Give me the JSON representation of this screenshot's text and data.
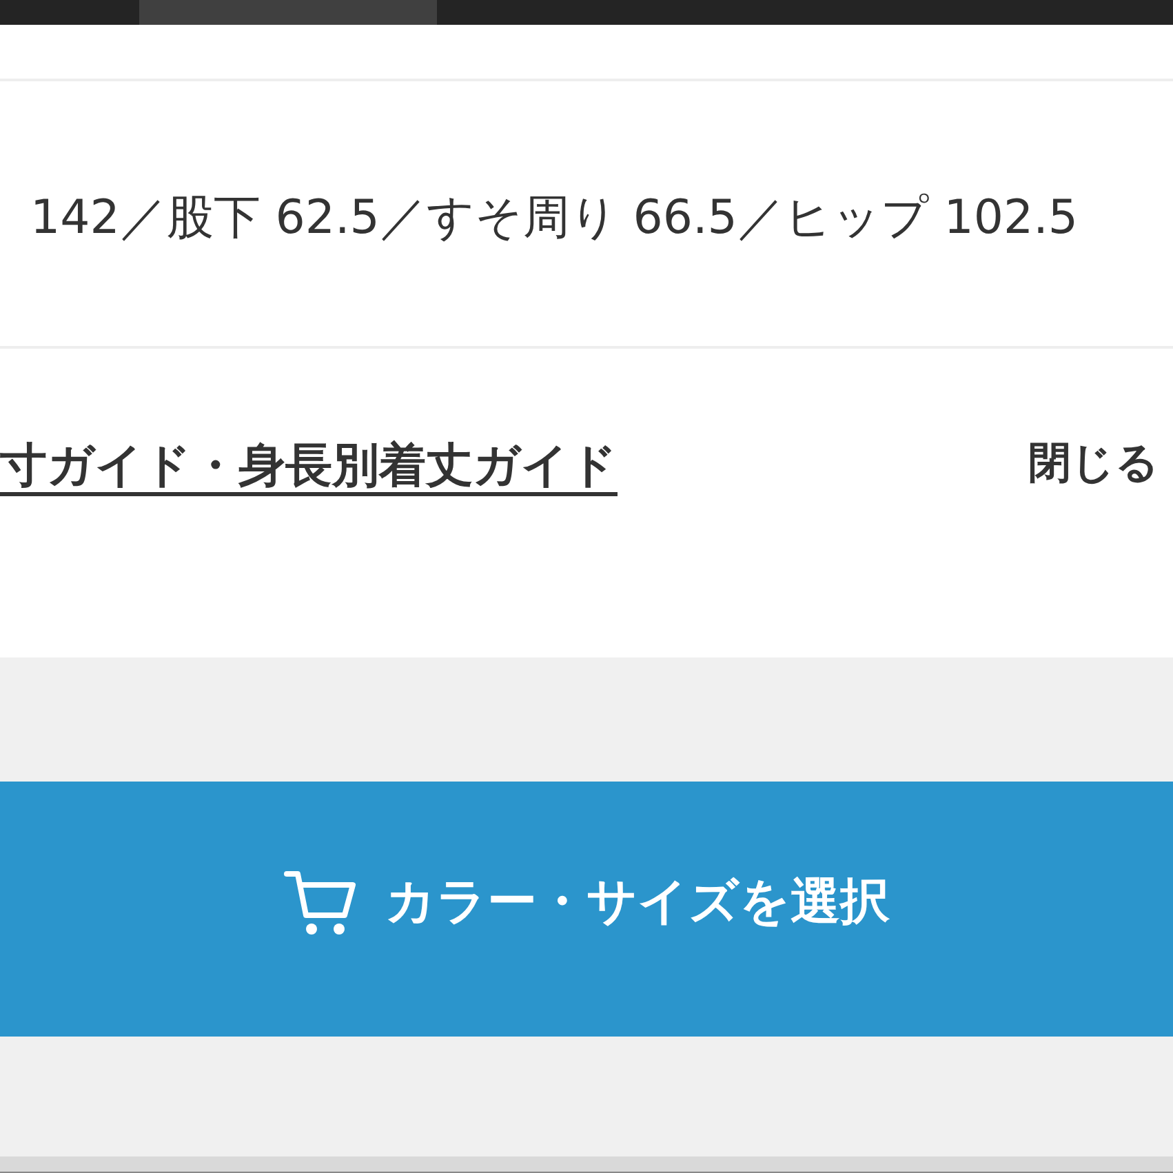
{
  "size_text": "142／股下 62.5／すそ周り 66.5／ヒップ 102.5",
  "guide_link": "寸ガイド・身長別着丈ガイド",
  "close_label": "閉じる",
  "cart_button": {
    "label": "カラー・サイズを選択"
  }
}
